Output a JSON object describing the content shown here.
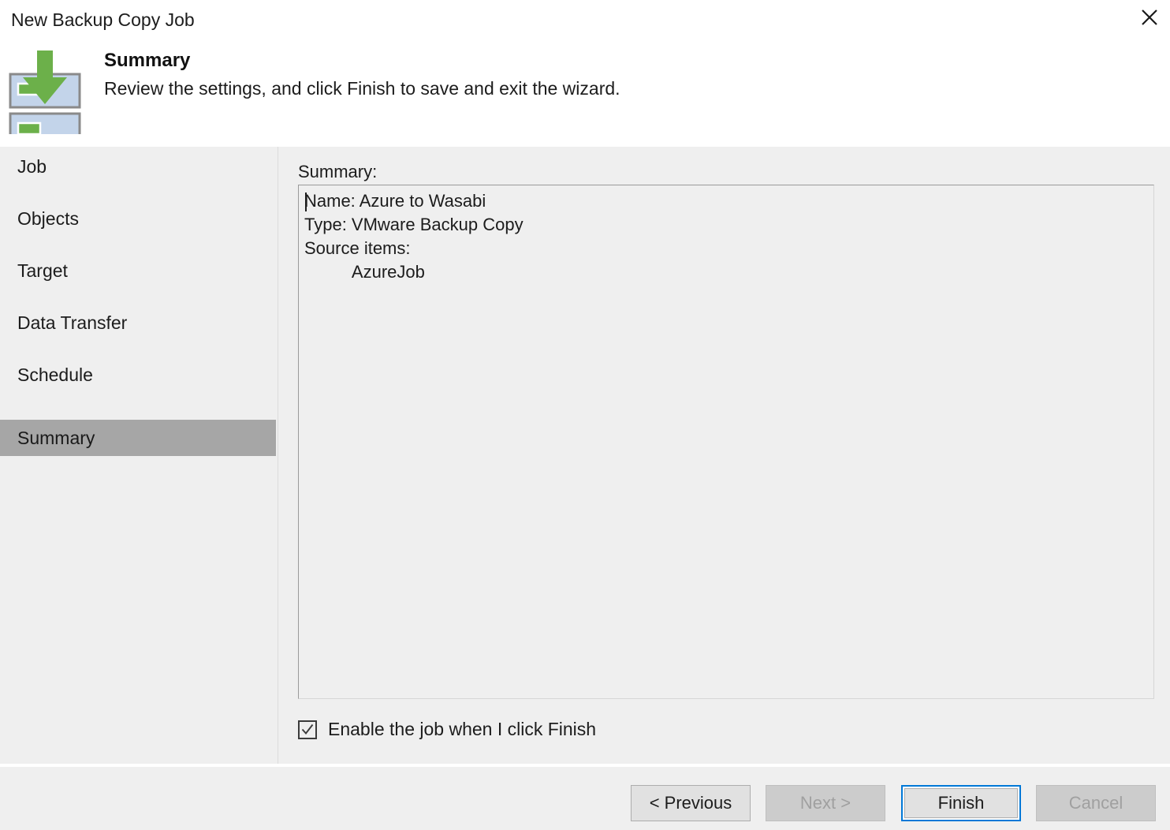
{
  "window": {
    "title": "New Backup Copy Job",
    "close_icon": "close-icon"
  },
  "header": {
    "icon": "backup-copy-job-icon",
    "title": "Summary",
    "subtitle": "Review the settings, and click Finish to save and exit the wizard."
  },
  "sidebar": {
    "items": [
      {
        "label": "Job",
        "selected": false
      },
      {
        "label": "Objects",
        "selected": false
      },
      {
        "label": "Target",
        "selected": false
      },
      {
        "label": "Data Transfer",
        "selected": false
      },
      {
        "label": "Schedule",
        "selected": false
      },
      {
        "label": "Summary",
        "selected": true
      }
    ]
  },
  "main": {
    "summary_label": "Summary:",
    "summary_text": "Name: Azure to Wasabi\nType: VMware Backup Copy\nSource items:\n          AzureJob",
    "summary_lines": [
      "Name: Azure to Wasabi",
      "Type: VMware Backup Copy",
      "Source items:",
      "          AzureJob"
    ],
    "enable_checkbox": {
      "label": "Enable the job when I click Finish",
      "checked": true
    }
  },
  "footer": {
    "buttons": [
      {
        "label": "< Previous",
        "state": "enabled"
      },
      {
        "label": "Next >",
        "state": "disabled"
      },
      {
        "label": "Finish",
        "state": "default"
      },
      {
        "label": "Cancel",
        "state": "disabled"
      }
    ]
  },
  "colors": {
    "dialog_background": "#efefef",
    "header_background": "#ffffff",
    "selection": "#a6a6a6",
    "focus_blue": "#0078d7",
    "icon_green": "#6cb04a",
    "icon_blue": "#c3d4ea"
  }
}
